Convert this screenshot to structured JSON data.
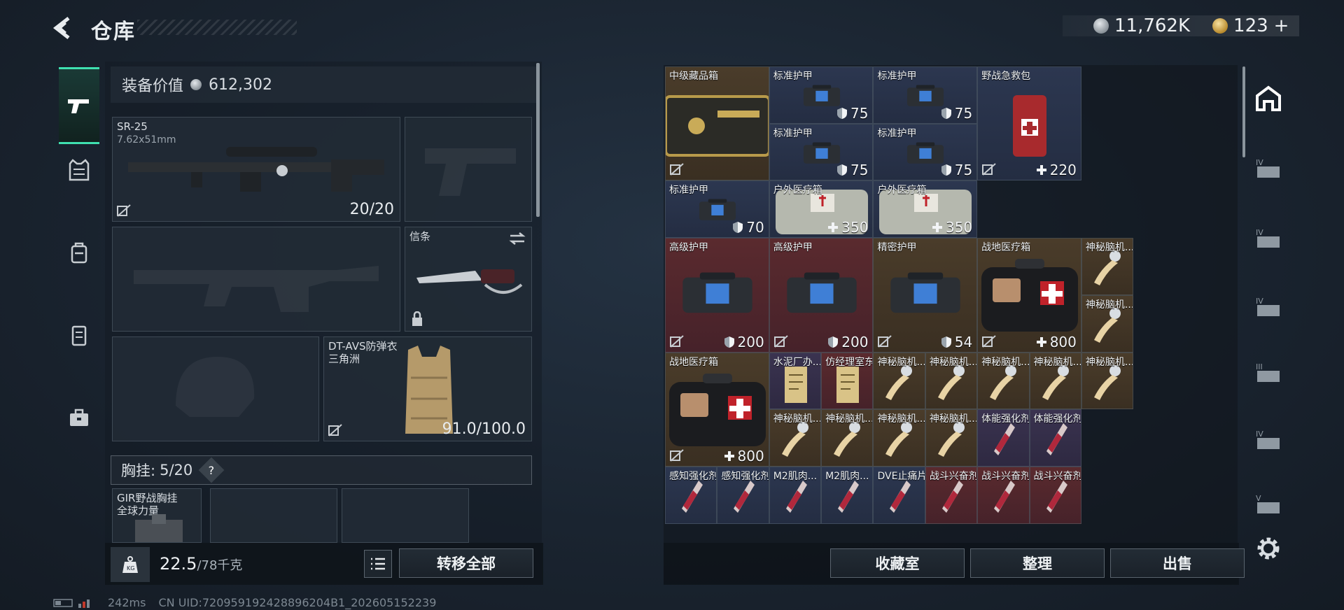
{
  "header": {
    "title": "仓库",
    "currency_silver": "11,762K",
    "currency_gold": "123",
    "currency_plus": "+"
  },
  "left_nav": [
    "weapon-icon",
    "vest-icon",
    "backpack-icon",
    "armor-icon",
    "toolbox-icon"
  ],
  "loadout": {
    "equip_value_label": "装备价值",
    "equip_value": "612,302",
    "primary": {
      "name": "SR-25",
      "caliber": "7.62x51mm",
      "ammo": "20/20"
    },
    "melee": {
      "name": "信条"
    },
    "armor": {
      "name": "DT-AVS防弹衣",
      "brand": "三角洲",
      "durability": "91.0/100.0"
    },
    "chest_rig": {
      "label": "胸挂:",
      "value": "5/20",
      "help": "?"
    },
    "rig_item": {
      "name": "GIR野战胸挂",
      "brand": "全球力量"
    },
    "weight": "22.5",
    "weight_max": "/78千克",
    "transfer_all": "转移全部"
  },
  "stash": [
    {
      "name": "中级藏品箱",
      "value": "",
      "rarity": "gold"
    },
    {
      "name": "标准护甲",
      "value": "75",
      "rarity": "blue"
    },
    {
      "name": "标准护甲",
      "value": "75",
      "rarity": "blue"
    },
    {
      "name": "野战急救包",
      "value": "220",
      "rarity": "blue"
    },
    {
      "name": "标准护甲",
      "value": "75",
      "rarity": "blue"
    },
    {
      "name": "标准护甲",
      "value": "75",
      "rarity": "blue"
    },
    {
      "name": "标准护甲",
      "value": "70",
      "rarity": "blue"
    },
    {
      "name": "户外医疗箱",
      "value": "350",
      "rarity": "blue"
    },
    {
      "name": "户外医疗箱",
      "value": "350",
      "rarity": "blue"
    },
    {
      "name": "高级护甲",
      "value": "200",
      "rarity": "red"
    },
    {
      "name": "高级护甲",
      "value": "200",
      "rarity": "red"
    },
    {
      "name": "精密护甲",
      "value": "54",
      "rarity": "gold"
    },
    {
      "name": "战地医疗箱",
      "value": "800",
      "rarity": "gold"
    },
    {
      "name": "神秘脑机...",
      "value": "",
      "rarity": "gold"
    },
    {
      "name": "神秘脑机...",
      "value": "",
      "rarity": "gold"
    },
    {
      "name": "战地医疗箱",
      "value": "800",
      "rarity": "gold"
    },
    {
      "name": "水泥厂办...",
      "value": "",
      "rarity": "purple"
    },
    {
      "name": "仿经理室东",
      "value": "",
      "rarity": "red"
    },
    {
      "name": "神秘脑机...",
      "value": "",
      "rarity": "gold"
    },
    {
      "name": "神秘脑机...",
      "value": "",
      "rarity": "gold"
    },
    {
      "name": "神秘脑机...",
      "value": "",
      "rarity": "gold"
    },
    {
      "name": "神秘脑机...",
      "value": "",
      "rarity": "gold"
    },
    {
      "name": "神秘脑机...",
      "value": "",
      "rarity": "gold"
    },
    {
      "name": "神秘脑机...",
      "value": "",
      "rarity": "gold"
    },
    {
      "name": "神秘脑机...",
      "value": "",
      "rarity": "gold"
    },
    {
      "name": "神秘脑机...",
      "value": "",
      "rarity": "gold"
    },
    {
      "name": "神秘脑机...",
      "value": "",
      "rarity": "gold"
    },
    {
      "name": "体能强化剂",
      "value": "",
      "rarity": "purple"
    },
    {
      "name": "体能强化剂",
      "value": "",
      "rarity": "purple"
    },
    {
      "name": "感知强化剂",
      "value": "",
      "rarity": "blue"
    },
    {
      "name": "感知强化剂",
      "value": "",
      "rarity": "blue"
    },
    {
      "name": "M2肌肉...",
      "value": "",
      "rarity": "blue"
    },
    {
      "name": "M2肌肉...",
      "value": "",
      "rarity": "blue"
    },
    {
      "name": "DVE止痛片",
      "value": "",
      "rarity": "blue"
    },
    {
      "name": "战斗兴奋剂",
      "value": "",
      "rarity": "red"
    },
    {
      "name": "战斗兴奋剂",
      "value": "",
      "rarity": "red"
    },
    {
      "name": "战斗兴奋剂",
      "value": "",
      "rarity": "red"
    }
  ],
  "right_nav": [
    "home-stash-icon",
    "iv-case-icon",
    "iv-case-icon",
    "iv-case-icon",
    "iii-case-icon",
    "iv-case-icon",
    "v-case-icon"
  ],
  "actions": {
    "collection": "收藏室",
    "sort": "整理",
    "sell": "出售"
  },
  "status": {
    "ping": "242ms",
    "uid": "CN UID:720959192428896204B1_202605152239"
  }
}
